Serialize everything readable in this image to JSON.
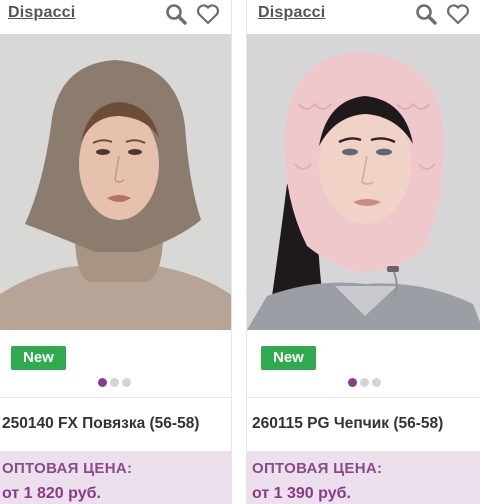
{
  "accent_color": "#8e3b8e",
  "badge_color": "#2eaa4f",
  "price_bg_color": "#ece0ec",
  "products": [
    {
      "brand": "Dispacci",
      "badge": "New",
      "title": "250140 FX Повязка (56-58)",
      "price_label": "ОПТОВАЯ ЦЕНА:",
      "price": "от 1 820 руб.",
      "image_dots": 3,
      "active_dot": 0,
      "image_desc_icon": "product-photo"
    },
    {
      "brand": "Dispacci",
      "badge": "New",
      "title": "260115 PG Чепчик (56-58)",
      "price_label": "ОПТОВАЯ ЦЕНА:",
      "price": "от 1 390 руб.",
      "image_dots": 3,
      "active_dot": 0,
      "image_desc_icon": "product-photo"
    }
  ]
}
